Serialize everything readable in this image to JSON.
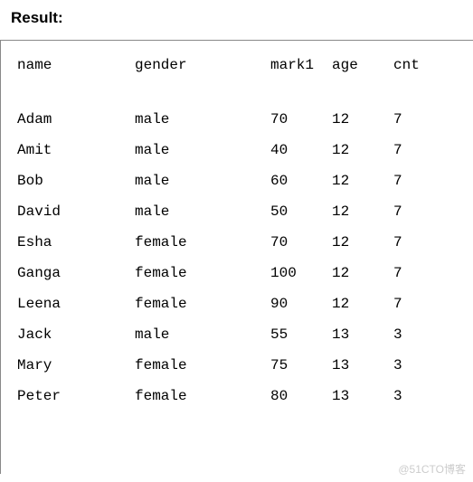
{
  "heading": "Result:",
  "columns": {
    "name": "name",
    "gender": "gender",
    "mark1": "mark1",
    "age": "age",
    "cnt": "cnt"
  },
  "rows": [
    {
      "name": "Adam",
      "gender": "male",
      "mark1": "70",
      "age": "12",
      "cnt": "7"
    },
    {
      "name": "Amit",
      "gender": "male",
      "mark1": "40",
      "age": "12",
      "cnt": "7"
    },
    {
      "name": "Bob",
      "gender": "male",
      "mark1": "60",
      "age": "12",
      "cnt": "7"
    },
    {
      "name": "David",
      "gender": "male",
      "mark1": "50",
      "age": "12",
      "cnt": "7"
    },
    {
      "name": "Esha",
      "gender": "female",
      "mark1": "70",
      "age": "12",
      "cnt": "7"
    },
    {
      "name": "Ganga",
      "gender": "female",
      "mark1": "100",
      "age": "12",
      "cnt": "7"
    },
    {
      "name": "Leena",
      "gender": "female",
      "mark1": "90",
      "age": "12",
      "cnt": "7"
    },
    {
      "name": "Jack",
      "gender": "male",
      "mark1": "55",
      "age": "13",
      "cnt": "3"
    },
    {
      "name": "Mary",
      "gender": "female",
      "mark1": "75",
      "age": "13",
      "cnt": "3"
    },
    {
      "name": "Peter",
      "gender": "female",
      "mark1": "80",
      "age": "13",
      "cnt": "3"
    }
  ],
  "watermark": "@51CTO博客"
}
